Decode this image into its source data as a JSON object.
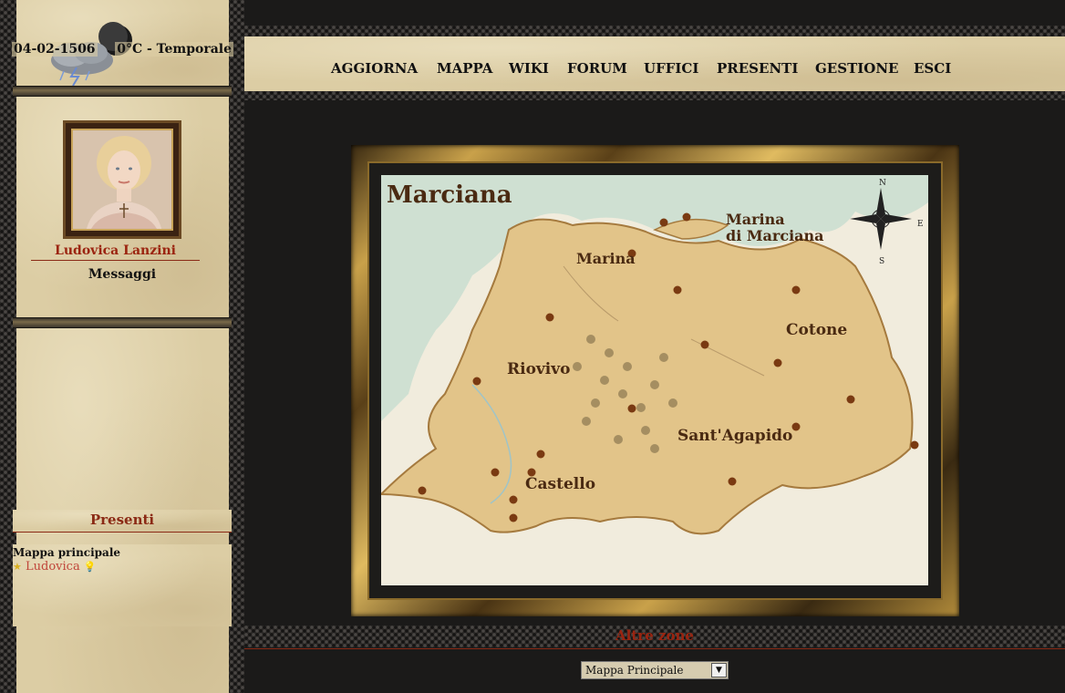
{
  "weather": {
    "date": "04-02-1506",
    "condition": "0°C - Temporale",
    "icon": "storm-cloud-moon-icon"
  },
  "character": {
    "name": "Ludovica Lanzini",
    "messages_label": "Messaggi"
  },
  "presenti": {
    "title": "Presenti",
    "area": "Mappa principale",
    "users": [
      {
        "name": "Ludovica"
      }
    ]
  },
  "nav": {
    "items": [
      "AGGIORNA",
      "MAPPA",
      "WIKI",
      "FORUM",
      "UFFICI",
      "PRESENTI",
      "GESTIONE",
      "ESCI"
    ]
  },
  "map": {
    "title": "Marciana",
    "places": [
      "Marina",
      "Marina",
      "di Marciana",
      "Cotone",
      "Riovivo",
      "Sant'Agapido",
      "Castello"
    ],
    "compass": [
      "N",
      "S",
      "E"
    ]
  },
  "footer": {
    "altre_zone": "Altre zone",
    "zone_select_value": "Mappa Principale"
  }
}
